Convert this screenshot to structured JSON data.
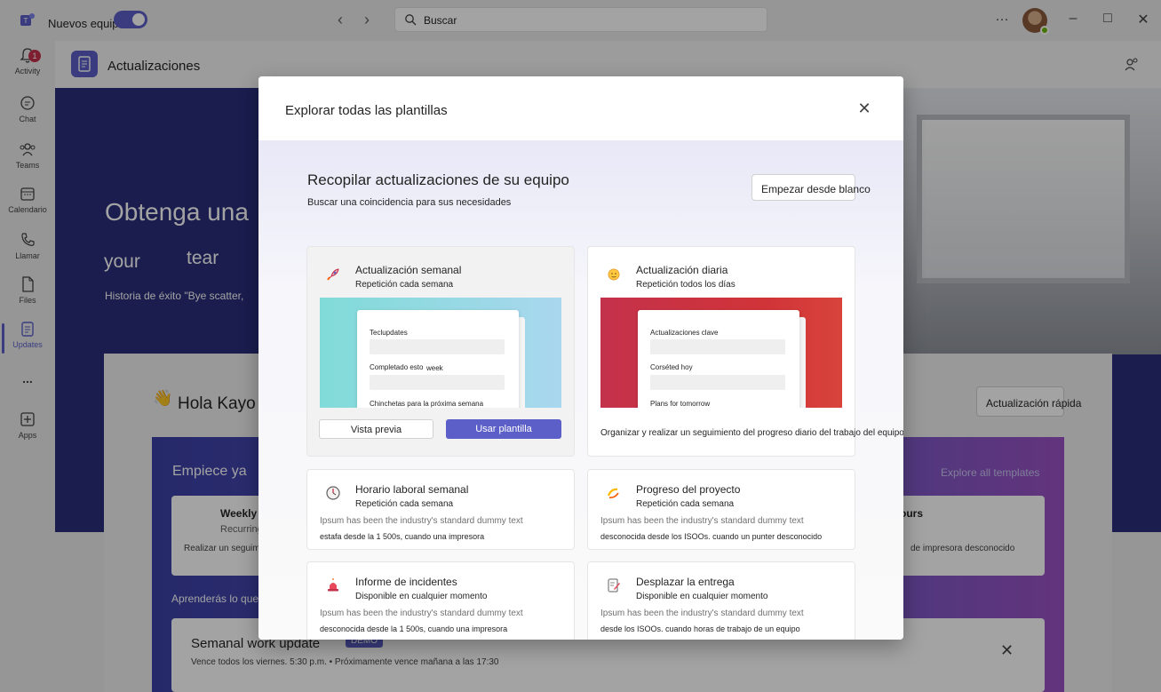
{
  "titlebar": {
    "new_teams_label": "Nuevos equipos",
    "search_placeholder": "Buscar",
    "more_label": "…"
  },
  "rail": {
    "items": [
      {
        "label": "Activity",
        "badge": "1"
      },
      {
        "label": "Chat"
      },
      {
        "label": "Teams"
      },
      {
        "label": "Calendario"
      },
      {
        "label": "Llamar"
      },
      {
        "label": "Files"
      },
      {
        "label": "Updates"
      },
      {
        "label": "..."
      },
      {
        "label": "Apps"
      }
    ]
  },
  "app": {
    "title": "Actualizaciones"
  },
  "hero": {
    "heading": "Obtenga una",
    "sub1": "your",
    "sub2": "tear",
    "small": "Historia de éxito \"Bye scatter,"
  },
  "background": {
    "hello": "Hola Kayo",
    "quick_update": "Actualización rápida",
    "start": "Empiece ya",
    "explore_all": "Explore all templates",
    "weekly_title": "Weekly",
    "recurring": "Recurring",
    "realizar": "Realizar un seguimi",
    "hours": "ours",
    "impresora": "de impresora desconocido",
    "aprenderas": "Aprenderás lo que",
    "semanal": "Semanal work update",
    "demo": "DEMO",
    "vence": "Vence todos los viernes. 5:30 p.m. • Próximamente vence mañana a las 17:30"
  },
  "dialog": {
    "title": "Explorar todas las plantillas",
    "section_title": "Recopilar actualizaciones de su equipo",
    "section_subtitle": "Buscar una coincidencia para sus necesidades",
    "blank_button": "Empezar desde blanco",
    "templates": [
      {
        "title": "Actualización semanal",
        "repeat": "Repetición cada semana",
        "preview_labels": [
          "Teclupdates",
          "Completado esto",
          "week",
          "Chinchetas para la próxima semana"
        ],
        "preview_button": "Vista previa",
        "use_button": "Usar plantilla"
      },
      {
        "title": "Actualización diaria",
        "repeat": "Repetición todos los días",
        "preview_labels": [
          "Actualizaciones clave",
          "Corséted hoy",
          "Plans for tomorrow"
        ],
        "description": "Organizar y realizar un seguimiento del progreso diario del trabajo del equipo"
      },
      {
        "title": "Horario laboral semanal",
        "repeat": "Repetición cada semana",
        "desc1": "Ipsum has been the industry's standard dummy text",
        "desc2": "estafa desde la 1 500s, cuando una impresora"
      },
      {
        "title": "Progreso del proyecto",
        "repeat": "Repetición cada semana",
        "desc1": "Ipsum has been the industry's standard dummy text",
        "desc2": "desconocida desde los ISOOs. cuando un punter desconocido"
      },
      {
        "title": "Informe de incidentes",
        "repeat": "Disponible en cualquier momento",
        "desc1": "Ipsum has been the industry's standard dummy text",
        "desc2": "desconocida desde la 1 500s, cuando una impresora"
      },
      {
        "title": "Desplazar la entrega",
        "repeat": "Disponible en cualquier momento",
        "desc1": "Ipsum has been the industry's standard dummy text",
        "desc2": "desde los ISOOs. cuando horas de trabajo de un equipo"
      }
    ]
  },
  "colors": {
    "brand": "#5b5fc7",
    "teal_preview": "#8fd6df",
    "red_preview": "#c4314b"
  }
}
